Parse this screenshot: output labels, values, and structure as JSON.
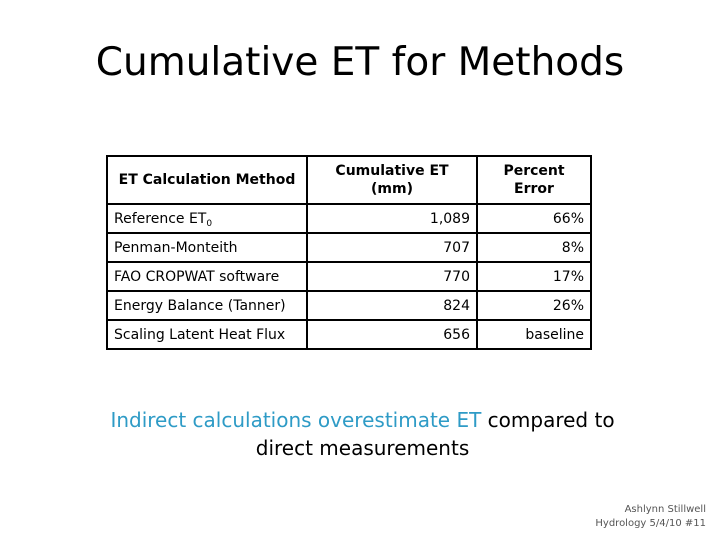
{
  "slide": {
    "title": "Cumulative ET for Methods",
    "table": {
      "headers": [
        "ET Calculation Method",
        "Cumulative ET (mm)",
        "Percent Error"
      ],
      "header_cumulative_line1": "Cumulative ET",
      "header_cumulative_line2": "(mm)",
      "rows": [
        {
          "method": "Reference ET",
          "method_sub": "0",
          "cumulative_et": "1,089",
          "percent_error": "66%"
        },
        {
          "method": "Penman-Monteith",
          "method_sub": "",
          "cumulative_et": "707",
          "percent_error": "8%"
        },
        {
          "method": "FAO CROPWAT software",
          "method_sub": "",
          "cumulative_et": "770",
          "percent_error": "17%"
        },
        {
          "method": "Energy Balance (Tanner)",
          "method_sub": "",
          "cumulative_et": "824",
          "percent_error": "26%"
        },
        {
          "method": "Scaling Latent Heat Flux",
          "method_sub": "",
          "cumulative_et": "656",
          "percent_error": "baseline"
        }
      ]
    },
    "note": {
      "highlight": "Indirect calculations overestimate ET",
      "rest_line1": " compared to",
      "line2": "direct measurements",
      "highlight_color": "#2e9bc6"
    },
    "footer": {
      "author": "Ashlynn Stillwell",
      "course": "Hydrology 5/4/10 #11"
    }
  }
}
